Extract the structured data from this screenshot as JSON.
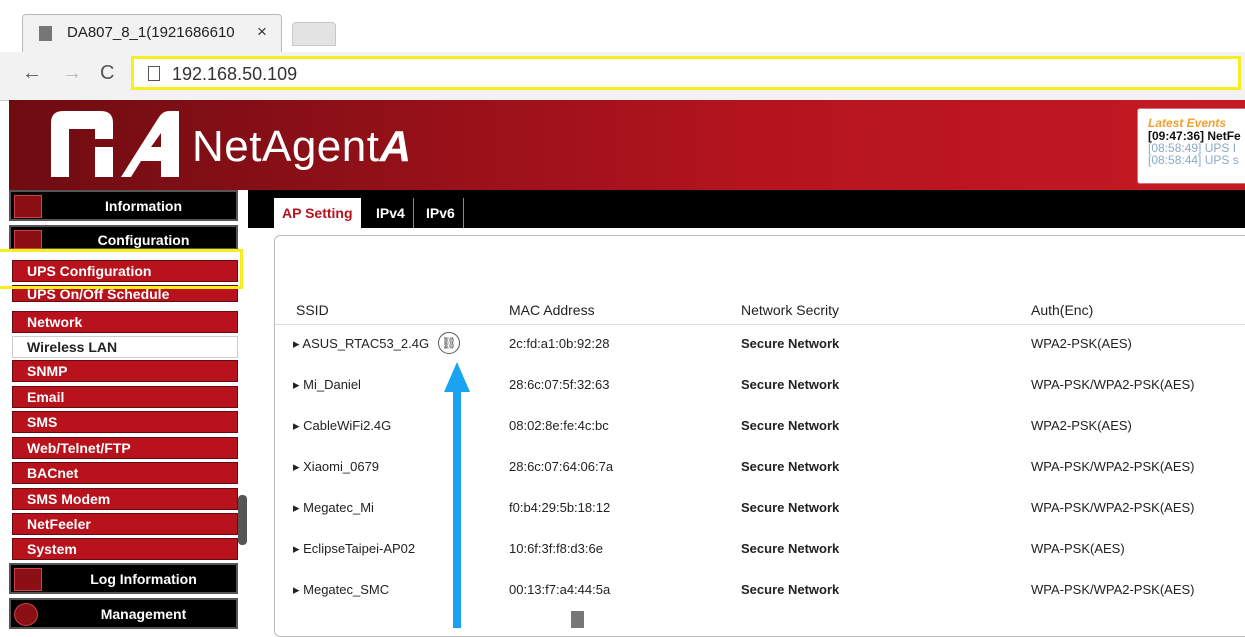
{
  "browser": {
    "tab_title": "DA807_8_1(1921686610",
    "tab_close": "×",
    "url": "192.168.50.109",
    "back": "←",
    "forward": "→",
    "reload": "C"
  },
  "header": {
    "logo_net": "Net",
    "logo_agent": "Agent",
    "logo_a": "A",
    "events_title": "Latest Events",
    "events": [
      "[09:47:36] NetFe",
      "[08:58:49] UPS I",
      "[08:58:44] UPS s"
    ]
  },
  "sidebar": {
    "sections": {
      "information": "Information",
      "configuration": "Configuration",
      "log": "Log Information",
      "management": "Management"
    },
    "items": [
      "UPS Configuration",
      "UPS On/Off Schedule",
      "Network",
      "Wireless LAN",
      "SNMP",
      "Email",
      "SMS",
      "Web/Telnet/FTP",
      "BACnet",
      "SMS Modem",
      "NetFeeler",
      "System"
    ]
  },
  "tabs": [
    "AP Setting",
    "IPv4",
    "IPv6"
  ],
  "table": {
    "headers": [
      "SSID",
      "MAC Address",
      "Network Secrity",
      "Auth(Enc)"
    ],
    "rows": [
      {
        "ssid": "ASUS_RTAC53_2.4G",
        "mac": "2c:fd:a1:0b:92:28",
        "security": "Secure Network",
        "auth": "WPA2-PSK(AES)"
      },
      {
        "ssid": "Mi_Daniel",
        "mac": "28:6c:07:5f:32:63",
        "security": "Secure Network",
        "auth": "WPA-PSK/WPA2-PSK(AES)"
      },
      {
        "ssid": "CableWiFi2.4G",
        "mac": "08:02:8e:fe:4c:bc",
        "security": "Secure Network",
        "auth": "WPA2-PSK(AES)"
      },
      {
        "ssid": "Xiaomi_0679",
        "mac": "28:6c:07:64:06:7a",
        "security": "Secure Network",
        "auth": "WPA-PSK/WPA2-PSK(AES)"
      },
      {
        "ssid": "Megatec_Mi",
        "mac": "f0:b4:29:5b:18:12",
        "security": "Secure Network",
        "auth": "WPA-PSK/WPA2-PSK(AES)"
      },
      {
        "ssid": "EclipseTaipei-AP02",
        "mac": "10:6f:3f:f8:d3:6e",
        "security": "Secure Network",
        "auth": "WPA-PSK(AES)"
      },
      {
        "ssid": "Megatec_SMC",
        "mac": "00:13:f7:a4:44:5a",
        "security": "Secure Network",
        "auth": "WPA-PSK/WPA2-PSK(AES)"
      }
    ]
  },
  "colors": {
    "brand_red": "#b8121c",
    "highlight": "#f6ee1e",
    "arrow": "#1aa3f0"
  }
}
